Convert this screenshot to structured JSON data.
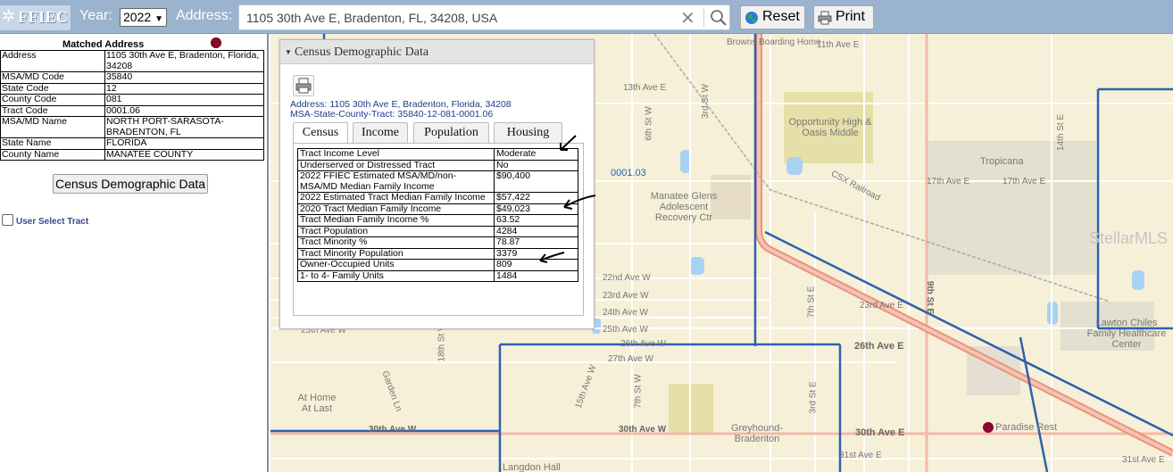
{
  "toolbar": {
    "logo_text": "FFIEC",
    "year_label": "Year:",
    "year_value": "2022",
    "address_label": "Address:",
    "address_value": "1105 30th Ave E, Bradenton, FL, 34208, USA",
    "reset_label": "Reset",
    "print_label": "Print"
  },
  "matched_address": {
    "title": "Matched Address",
    "rows": [
      {
        "key": "Address",
        "value": "1105 30th Ave E, Bradenton, Florida, 34208"
      },
      {
        "key": "MSA/MD Code",
        "value": "35840"
      },
      {
        "key": "State Code",
        "value": "12"
      },
      {
        "key": "County Code",
        "value": "081"
      },
      {
        "key": "Tract Code",
        "value": "0001.06"
      },
      {
        "key": "MSA/MD Name",
        "value": "NORTH PORT-SARASOTA-BRADENTON, FL"
      },
      {
        "key": "State Name",
        "value": "FLORIDA"
      },
      {
        "key": "County Name",
        "value": "MANATEE COUNTY"
      }
    ],
    "census_button": "Census Demographic Data",
    "user_select_tract": "User Select Tract"
  },
  "popup": {
    "title": "Census Demographic Data",
    "address_line": "Address: 1105 30th Ave E, Bradenton, Florida, 34208",
    "tract_line": "MSA-State-County-Tract: 35840-12-081-0001.06",
    "tabs": [
      "Census",
      "Income",
      "Population",
      "Housing"
    ],
    "active_tab": "Census",
    "rows": [
      {
        "key": "Tract Income Level",
        "value": "Moderate"
      },
      {
        "key": "Underserved or Distressed Tract",
        "value": "No"
      },
      {
        "key": "2022 FFIEC Estimated MSA/MD/non-MSA/MD Median Family Income",
        "value": "$90,400"
      },
      {
        "key": "2022 Estimated Tract Median Family Income",
        "value": "$57,422"
      },
      {
        "key": "2020 Tract Median Family Income",
        "value": "$49,023"
      },
      {
        "key": "Tract Median Family Income %",
        "value": "63.52"
      },
      {
        "key": "Tract Population",
        "value": "4284"
      },
      {
        "key": "Tract Minority %",
        "value": "78.87"
      },
      {
        "key": "Tract Minority Population",
        "value": "3379"
      },
      {
        "key": "Owner-Occupied Units",
        "value": "809"
      },
      {
        "key": "1- to 4- Family Units",
        "value": "1484"
      }
    ]
  },
  "map": {
    "tract_label": "0001.03",
    "watermark": "StellarMLS",
    "labels": {
      "brownsboarding": "Browns Boarding Home",
      "ave11": "11th Ave E",
      "ave13": "13th Ave E",
      "opportunity": "Opportunity High & Oasis Middle",
      "manatee": "Manatee Glens Adolescent Recovery Ctr",
      "tropicana": "Tropicana",
      "ave17": "17th Ave E",
      "ave17b": "17th Ave E",
      "csx": "CSX Railroad",
      "st9": "9th St E",
      "ave22": "22nd Ave W",
      "ave23": "23rd Ave W",
      "ave24": "24th Ave W",
      "ave25w": "25th Ave W",
      "ave25": "25th Ave W",
      "ave26": "26th Ave W",
      "ave26e": "26th Ave E",
      "ave27": "27th Ave W",
      "athome": "At Home At Last",
      "ave30w": "30th Ave W",
      "ave30wb": "30th Ave W",
      "greyhound": "Greyhound-Bradenton",
      "ave30e": "30th Ave E",
      "paradise": "Paradise Rest",
      "lawton": "Lawton Chiles Family Healthcare Center",
      "langdon": "Langdon Hall",
      "ave31e": "31st Ave E",
      "ave31eb": "31st Ave E",
      "ave23e": "23rd Ave E",
      "st3w": "3rd St W",
      "st6w": "6th St W",
      "st14e": "14th St E",
      "st7": "7th St E",
      "st7w": "7th St W",
      "ave15": "15th Ave W",
      "st18": "18th St W",
      "stGarden": "Garden Ln",
      "st3e": "3rd St E"
    }
  }
}
